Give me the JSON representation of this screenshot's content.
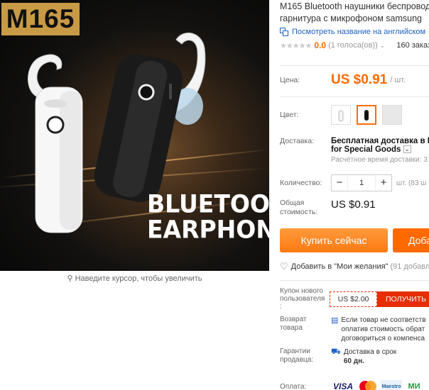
{
  "image": {
    "badge": "M165",
    "headline_line1": "BLUETOOTH",
    "headline_line2": "EARPHONE",
    "zoom_hint": "Наведите курсор, чтобы увеличить"
  },
  "product": {
    "title": "M165 Bluetooth наушники беспроводные Bluetooth гарнитура с микрофоном samsung",
    "translate_link": "Посмотреть название на английском",
    "rating_score": "0.0",
    "rating_votes": "(1 голоса(ов))",
    "orders": "160 заказ"
  },
  "price": {
    "label": "Цена:",
    "value": "US $0.91",
    "unit": "/ шт."
  },
  "color": {
    "label": "Цвет:",
    "options": [
      "white",
      "black",
      "gray"
    ],
    "selected": "black"
  },
  "shipping": {
    "label": "Доставка:",
    "line1": "Бесплатная доставка в Rus",
    "line2": "for Special Goods",
    "eta": "Расчётное время доставки: 3"
  },
  "quantity": {
    "label": "Количество:",
    "value": "1",
    "minus": "−",
    "plus": "+",
    "unit_available": "шт. (83 ш"
  },
  "total": {
    "label_line1": "Общая",
    "label_line2": "стоимость:",
    "value": "US $0.91"
  },
  "actions": {
    "buy_now": "Купить сейчас",
    "add_to_cart": "Доба"
  },
  "wishlist": {
    "label": "Добавить в \"Мои желания\"",
    "count": "(91 добавле"
  },
  "coupon": {
    "label_line1": "Купон нового",
    "label_line2": "пользователя",
    "label_line3": ":",
    "amount": "US $2.00",
    "get_label": "ПОЛУЧИТЬ"
  },
  "returns": {
    "label_line1": "Возврат",
    "label_line2": "товара",
    "text_line1": "Если товар не соответств",
    "text_line2": "оплатив стоимость обрат",
    "text_line3": "договориться о компенса"
  },
  "guarantee": {
    "label_line1": "Гарантии",
    "label_line2": "продавца:",
    "text_line1": "Доставка в срок",
    "text_line2": "60 дн."
  },
  "payment": {
    "label": "Оплата:",
    "visa": "VISA",
    "maestro": "Maestro"
  },
  "colors": {
    "accent": "#ff6a00",
    "link": "#1e62c4",
    "coupon_red": "#e62e04",
    "badge_gold": "#c99a45"
  }
}
